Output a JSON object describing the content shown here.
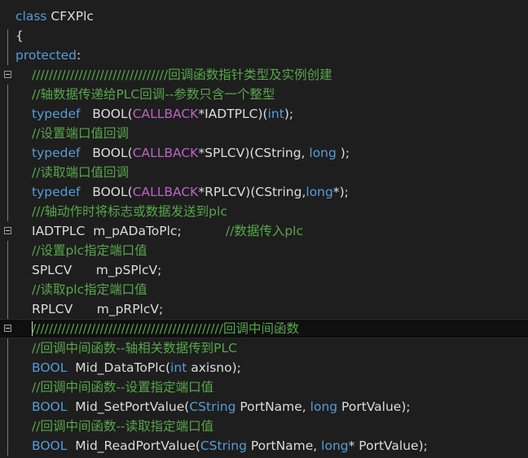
{
  "editor": {
    "language": "C++",
    "colors": {
      "background": "#1e1e1e",
      "keyword": "#569cd6",
      "macro": "#bd63c5",
      "comment": "#57a64a",
      "text": "#dcdcdc"
    },
    "lines": [
      {
        "indent": 0,
        "tokens": [
          {
            "t": "class",
            "c": "kw"
          },
          {
            "t": " CFXPlc",
            "c": "tx"
          }
        ]
      },
      {
        "indent": 0,
        "tokens": [
          {
            "t": "{",
            "c": "tx"
          }
        ]
      },
      {
        "indent": 0,
        "tokens": [
          {
            "t": "protected",
            "c": "kw"
          },
          {
            "t": ":",
            "c": "tx"
          }
        ]
      },
      {
        "indent": 1,
        "tokens": [
          {
            "t": "////////////////////////////////回调函数指针类型及实例创建",
            "c": "cm"
          }
        ]
      },
      {
        "indent": 1,
        "tokens": [
          {
            "t": "//轴数据传递给PLC回调--参数只含一个整型",
            "c": "cm"
          }
        ]
      },
      {
        "indent": 1,
        "tokens": [
          {
            "t": "typedef",
            "c": "kw"
          },
          {
            "t": "   BOOL(",
            "c": "tx"
          },
          {
            "t": "CALLBACK",
            "c": "mac"
          },
          {
            "t": "*IADTPLC)(",
            "c": "tx"
          },
          {
            "t": "int",
            "c": "kw"
          },
          {
            "t": ");",
            "c": "tx"
          }
        ]
      },
      {
        "indent": 1,
        "tokens": [
          {
            "t": "//设置端口值回调",
            "c": "cm"
          }
        ]
      },
      {
        "indent": 1,
        "tokens": [
          {
            "t": "typedef",
            "c": "kw"
          },
          {
            "t": "   BOOL(",
            "c": "tx"
          },
          {
            "t": "CALLBACK",
            "c": "mac"
          },
          {
            "t": "*SPLCV)(CString, ",
            "c": "tx"
          },
          {
            "t": "long",
            "c": "kw"
          },
          {
            "t": " );",
            "c": "tx"
          }
        ]
      },
      {
        "indent": 1,
        "tokens": [
          {
            "t": "//读取端口值回调",
            "c": "cm"
          }
        ]
      },
      {
        "indent": 1,
        "tokens": [
          {
            "t": "typedef",
            "c": "kw"
          },
          {
            "t": "   BOOL(",
            "c": "tx"
          },
          {
            "t": "CALLBACK",
            "c": "mac"
          },
          {
            "t": "*RPLCV)(CString,",
            "c": "tx"
          },
          {
            "t": "long",
            "c": "kw"
          },
          {
            "t": "*);",
            "c": "tx"
          }
        ]
      },
      {
        "indent": 1,
        "tokens": [
          {
            "t": "///轴动作时将标志或数据发送到plc",
            "c": "cm"
          }
        ]
      },
      {
        "indent": 1,
        "tokens": [
          {
            "t": "IADTPLC  m_pADaToPlc;           ",
            "c": "tx"
          },
          {
            "t": "//数据传入plc",
            "c": "cm"
          }
        ]
      },
      {
        "indent": 1,
        "tokens": [
          {
            "t": "//设置plc指定端口值",
            "c": "cm"
          }
        ]
      },
      {
        "indent": 1,
        "tokens": [
          {
            "t": "SPLCV      m_pSPlcV;",
            "c": "tx"
          }
        ]
      },
      {
        "indent": 1,
        "tokens": [
          {
            "t": "//读取plc指定端口值",
            "c": "cm"
          }
        ]
      },
      {
        "indent": 1,
        "tokens": [
          {
            "t": "RPLCV      m_pRPlcV;",
            "c": "tx"
          }
        ]
      },
      {
        "indent": 1,
        "tokens": [
          {
            "t": "/////////////////////////////////////////////回调中间函数",
            "c": "cm"
          }
        ]
      },
      {
        "indent": 1,
        "tokens": [
          {
            "t": "//回调中间函数--轴相关数据传到PLC",
            "c": "cm"
          }
        ]
      },
      {
        "indent": 1,
        "tokens": [
          {
            "t": "BOOL",
            "c": "kw"
          },
          {
            "t": "  Mid_DataToPlc(",
            "c": "tx"
          },
          {
            "t": "int",
            "c": "kw"
          },
          {
            "t": " axisno);",
            "c": "tx"
          }
        ]
      },
      {
        "indent": 1,
        "tokens": [
          {
            "t": "//回调中间函数--设置指定端口值",
            "c": "cm"
          }
        ]
      },
      {
        "indent": 1,
        "tokens": [
          {
            "t": "BOOL",
            "c": "kw"
          },
          {
            "t": "  Mid_SetPortValue(",
            "c": "tx"
          },
          {
            "t": "CString",
            "c": "kw"
          },
          {
            "t": " PortName, ",
            "c": "tx"
          },
          {
            "t": "long",
            "c": "kw"
          },
          {
            "t": " PortValue);",
            "c": "tx"
          }
        ]
      },
      {
        "indent": 1,
        "tokens": [
          {
            "t": "//回调中间函数--读取指定端口值",
            "c": "cm"
          }
        ]
      },
      {
        "indent": 1,
        "tokens": [
          {
            "t": "BOOL",
            "c": "kw"
          },
          {
            "t": "  Mid_ReadPortValue(",
            "c": "tx"
          },
          {
            "t": "CString",
            "c": "kw"
          },
          {
            "t": " PortName, ",
            "c": "tx"
          },
          {
            "t": "long",
            "c": "kw"
          },
          {
            "t": "* PortValue);",
            "c": "tx"
          }
        ]
      }
    ],
    "fold_markers": [
      {
        "line": 4,
        "name": "fold-collapse-icon"
      },
      {
        "line": 12,
        "name": "fold-collapse-icon"
      },
      {
        "line": 17,
        "name": "fold-collapse-icon"
      }
    ],
    "current_line": 17
  }
}
